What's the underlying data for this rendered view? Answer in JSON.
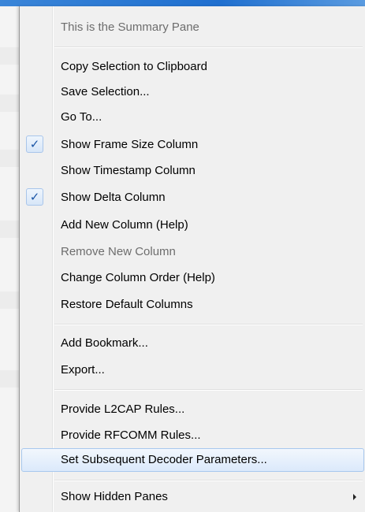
{
  "menu": {
    "header": "This is the Summary Pane",
    "items": [
      {
        "label": "Copy Selection to Clipboard"
      },
      {
        "label": "Save Selection..."
      },
      {
        "label": "Go To..."
      },
      {
        "label": "Show Frame Size Column",
        "checked": true
      },
      {
        "label": "Show Timestamp Column"
      },
      {
        "label": "Show Delta Column",
        "checked": true
      },
      {
        "label": "Add New Column (Help)"
      },
      {
        "label": "Remove New Column",
        "disabled": true
      },
      {
        "label": "Change Column Order (Help)"
      },
      {
        "label": "Restore Default Columns"
      },
      {
        "label": "Add Bookmark..."
      },
      {
        "label": "Export..."
      },
      {
        "label": "Provide L2CAP Rules..."
      },
      {
        "label": "Provide RFCOMM Rules..."
      },
      {
        "label": "Set Subsequent Decoder Parameters...",
        "highlighted": true
      },
      {
        "label": "Show Hidden Panes",
        "submenu": true
      }
    ],
    "check_glyph": "✓"
  },
  "colors": {
    "menu_background": "#f0f0f0",
    "highlight_border": "#a8c8ee",
    "check_color": "#1a55a6",
    "disabled_text": "#6d6d6d"
  }
}
